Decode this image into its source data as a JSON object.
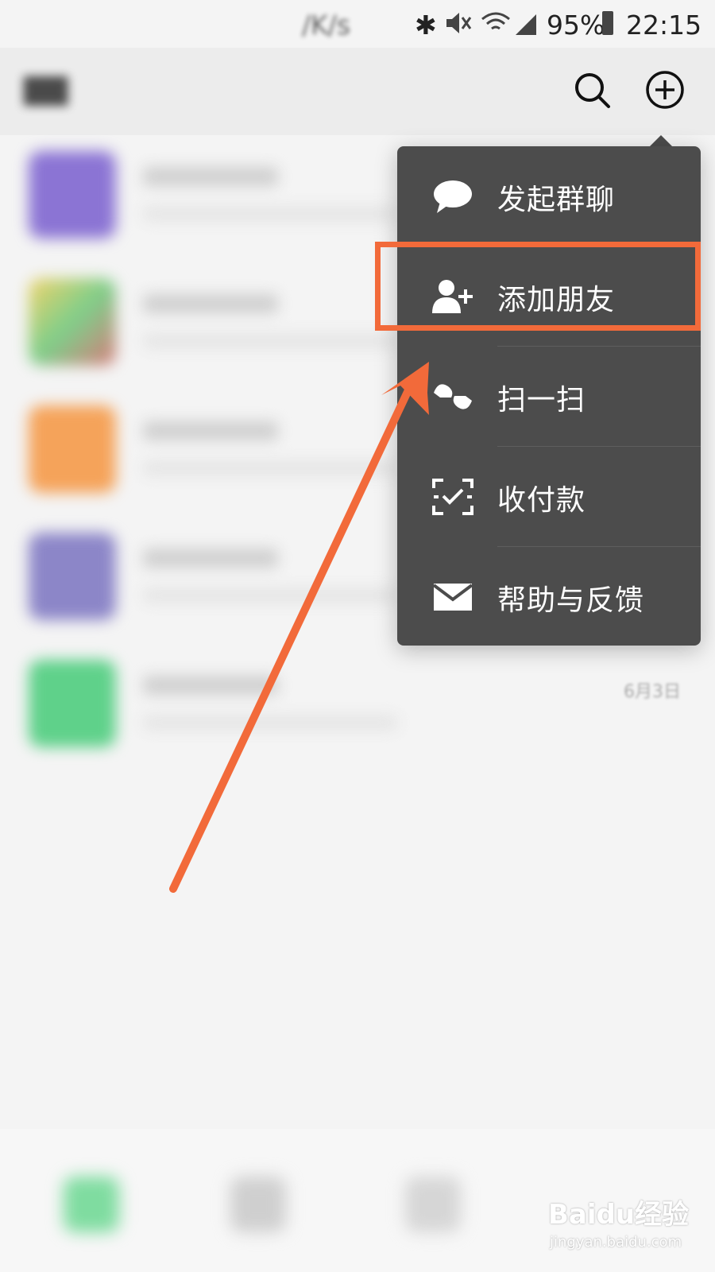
{
  "status_bar": {
    "speed": "/K/s",
    "battery_percent": "95%",
    "time": "22:15"
  },
  "menu": {
    "items": [
      {
        "label": "发起群聊",
        "icon": "chat-bubble-icon"
      },
      {
        "label": "添加朋友",
        "icon": "add-friend-icon"
      },
      {
        "label": "扫一扫",
        "icon": "scan-icon"
      },
      {
        "label": "收付款",
        "icon": "money-scan-icon"
      },
      {
        "label": "帮助与反馈",
        "icon": "mail-icon"
      }
    ],
    "highlighted_index": 1
  },
  "chat_list": {
    "visible_date": "6月3日"
  },
  "watermark": {
    "brand": "Baidu经验",
    "url": "jingyan.baidu.com"
  },
  "colors": {
    "menu_bg": "#4c4c4c",
    "annotation": "#f26a3a",
    "avatar_colors": [
      "#8b74d4",
      "#b9cf86",
      "#f5a35a",
      "#8c86c8",
      "#5fd18a"
    ]
  }
}
